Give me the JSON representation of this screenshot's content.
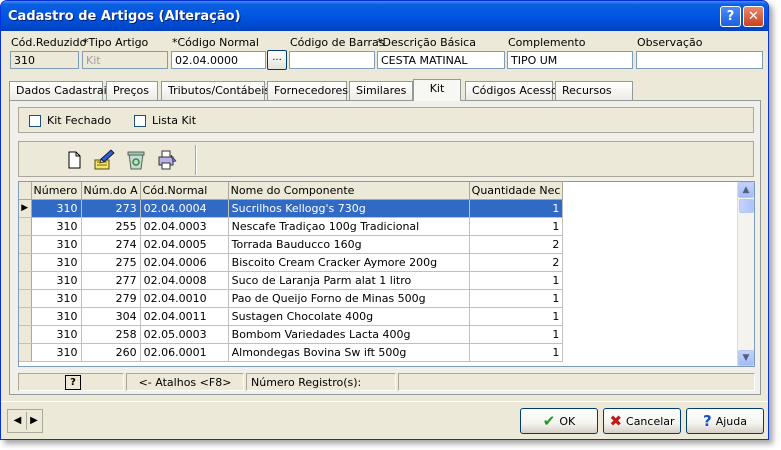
{
  "window": {
    "title": "Cadastro de Artigos (Alteração)",
    "help_glyph": "?",
    "close_glyph": "✕"
  },
  "fields": {
    "cod_reduzido": {
      "label": "Cód.Reduzido",
      "value": "310"
    },
    "tipo_artigo": {
      "label": "*Tipo Artigo",
      "value": "Kit"
    },
    "codigo_normal": {
      "label": "*Código Normal",
      "value": "02.04.0000",
      "button": "..."
    },
    "codigo_barras": {
      "label": "Código de Barras",
      "value": ""
    },
    "descricao_basica": {
      "label": "*Descrição Básica",
      "value": "CESTA MATINAL"
    },
    "complemento": {
      "label": "Complemento",
      "value": "TIPO UM"
    },
    "observacao": {
      "label": "Observação",
      "value": ""
    }
  },
  "tabs": [
    {
      "label": "Dados Cadastrais"
    },
    {
      "label": "Preços"
    },
    {
      "label": "Tributos/Contábeis"
    },
    {
      "label": "Fornecedores"
    },
    {
      "label": "Similares"
    },
    {
      "label": "Kit"
    },
    {
      "label": "Códigos Acesso"
    },
    {
      "label": "Recursos"
    }
  ],
  "kit": {
    "kit_fechado_label": "Kit Fechado",
    "lista_kit_label": "Lista Kit"
  },
  "toolbar": {
    "icons": [
      "new-document-icon",
      "edit-icon",
      "recycle-bin-icon",
      "print-icon"
    ]
  },
  "grid": {
    "columns": [
      "Número",
      "Núm.do A",
      "Cód.Normal",
      "Nome do Componente",
      "Quantidade Nec"
    ],
    "rows": [
      [
        "310",
        "273",
        "02.04.0004",
        "Sucrilhos Kellogg's 730g",
        "1"
      ],
      [
        "310",
        "255",
        "02.04.0003",
        "Nescafe Tradiçao 100g Tradicional",
        "1"
      ],
      [
        "310",
        "274",
        "02.04.0005",
        "Torrada Bauducco 160g",
        "2"
      ],
      [
        "310",
        "275",
        "02.04.0006",
        "Biscoito Cream Cracker Aymore 200g",
        "2"
      ],
      [
        "310",
        "277",
        "02.04.0008",
        "Suco de Laranja Parm alat 1 litro",
        "1"
      ],
      [
        "310",
        "279",
        "02.04.0010",
        "Pao de Queijo Forno de Minas 500g",
        "1"
      ],
      [
        "310",
        "304",
        "02.04.0011",
        "Sustagen Chocolate 400g",
        "1"
      ],
      [
        "310",
        "258",
        "02.05.0003",
        "Bombom Variedades Lacta 400g",
        "1"
      ],
      [
        "310",
        "260",
        "02.06.0001",
        "Almondegas Bovina Sw ift 500g",
        "1"
      ]
    ],
    "selected_row": 0,
    "row_indicator": "▶"
  },
  "status": {
    "help_glyph": "?",
    "atalhos": "<- Atalhos <F8>",
    "registro": "Número Registro(s):"
  },
  "nav": {
    "prev": "◀",
    "next": "▶"
  },
  "buttons": {
    "ok": "OK",
    "cancelar": "Cancelar",
    "ajuda": "Ajuda",
    "ok_icon": "✔",
    "cancel_icon": "✖",
    "help_icon": "?"
  },
  "colors": {
    "titlebar": "#0055e5",
    "selection": "#316ac5",
    "face": "#ece9d8"
  }
}
